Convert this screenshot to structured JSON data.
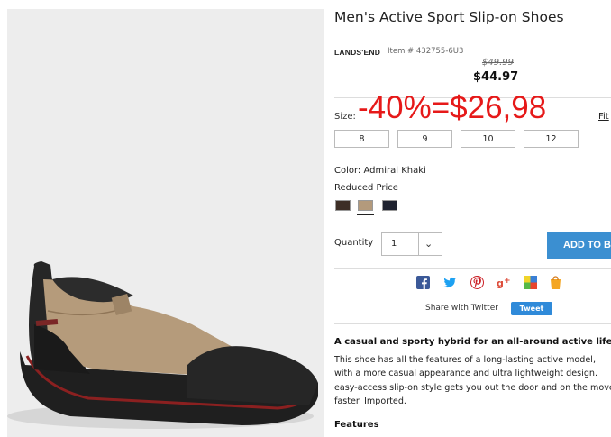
{
  "product": {
    "title": "Men's Active Sport Slip-on Shoes",
    "brand": "LANDS'END",
    "item_number": "Item # 432755-6U3",
    "original_price": "$49.99",
    "sale_price": "$44.97"
  },
  "promo_overlay": "-40%=$26,98",
  "size": {
    "label": "Size:",
    "fit_link": "Fit",
    "options": [
      "8",
      "9",
      "10",
      "12"
    ]
  },
  "color": {
    "label": "Color: Admiral Khaki",
    "reduced_label": "Reduced Price",
    "swatches": [
      {
        "name": "dark-brown",
        "hex": "#3d2e26"
      },
      {
        "name": "admiral-khaki",
        "hex": "#b39a7c",
        "selected": true
      },
      {
        "name": "navy",
        "hex": "#1f2330"
      }
    ]
  },
  "quantity": {
    "label": "Quantity",
    "value": "1"
  },
  "add_to_bag": "ADD TO BAG",
  "share": {
    "icons": [
      "facebook-icon",
      "twitter-icon",
      "pinterest-icon",
      "google-plus-icon",
      "delicious-icon",
      "shopping-bag-icon"
    ],
    "text": "Share with Twitter",
    "tweet": "Tweet"
  },
  "description": {
    "heading": "A casual and sporty hybrid for an all-around active lifestyle",
    "lines": [
      "This shoe has all the features of a long-lasting active model,",
      "with a more casual appearance and ultra lightweight design.",
      "easy-access slip-on style gets you out the door and on the move",
      "faster. Imported."
    ],
    "features_label": "Features"
  },
  "colors": {
    "promo_red": "#e61919",
    "button_blue": "#3b8fd1",
    "tweet_blue": "#2f8ad9"
  }
}
